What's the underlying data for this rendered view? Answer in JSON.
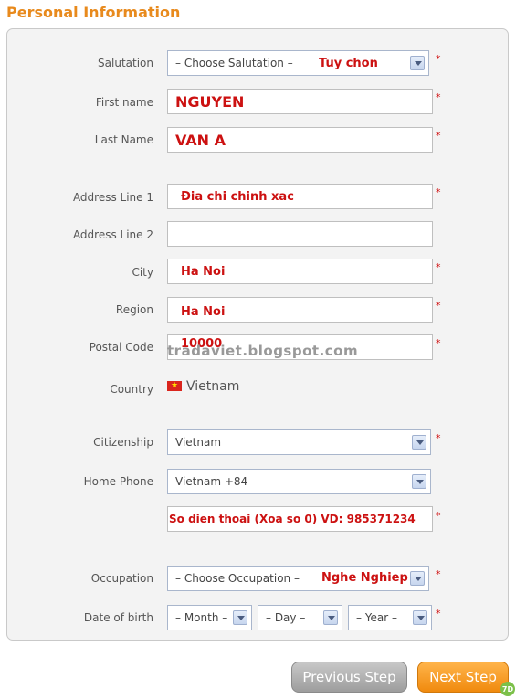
{
  "page": {
    "title": "Personal Information"
  },
  "form": {
    "salutation": {
      "label": "Salutation",
      "value": "– Choose Salutation –",
      "annotation": "Tuy chon"
    },
    "first_name": {
      "label": "First name",
      "value": "NGUYEN"
    },
    "last_name": {
      "label": "Last Name",
      "value": "VAN A"
    },
    "address1": {
      "label": "Address Line 1",
      "value": "Đia chi chinh xac"
    },
    "address2": {
      "label": "Address Line 2",
      "value": ""
    },
    "city": {
      "label": "City",
      "value": "Ha Noi"
    },
    "region": {
      "label": "Region",
      "value": "Ha Noi"
    },
    "postal": {
      "label": "Postal Code",
      "value": "10000"
    },
    "country": {
      "label": "Country",
      "value": "Vietnam",
      "flag_icon": "vietnam-flag-icon"
    },
    "citizenship": {
      "label": "Citizenship",
      "value": "Vietnam"
    },
    "home_phone": {
      "label": "Home Phone",
      "value": "Vietnam +84",
      "number": "So dien thoai (Xoa so 0) VD: 985371234"
    },
    "occupation": {
      "label": "Occupation",
      "value": "– Choose Occupation –",
      "annotation": "Nghe Nghiep"
    },
    "dob": {
      "label": "Date of birth",
      "month": "– Month –",
      "day": "– Day –",
      "year": "– Year –"
    },
    "required_mark": "*"
  },
  "watermark": "tradaviet.blogspot.com",
  "buttons": {
    "previous": "Previous Step",
    "next": "Next Step"
  },
  "badge": "7D",
  "colors": {
    "title": "#e88a1d",
    "annotation": "#cc1111",
    "next_button": "#f08a0e",
    "prev_button": "#a8a8a8"
  }
}
